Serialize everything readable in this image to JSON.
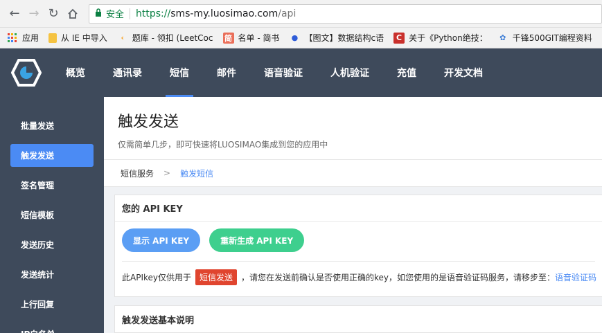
{
  "browser": {
    "secure_label": "安全",
    "url_proto": "https://",
    "url_host": "sms-my.luosimao.com",
    "url_path": "/api"
  },
  "bookmarks": [
    {
      "label": "应用",
      "icon": "apps-grid-icon",
      "color": "#e94235"
    },
    {
      "label": "从 IE 中导入",
      "icon": "folder-icon",
      "color": "#f5c342"
    },
    {
      "label": "题库 - 领扣 (LeetCoc",
      "icon": "leetcode-icon",
      "color": "#f89f1b"
    },
    {
      "label": "名单 - 简书",
      "icon": "jianshu-icon",
      "color": "#ea6f5a"
    },
    {
      "label": "【图文】数据结构c语",
      "icon": "baidu-paw-icon",
      "color": "#2e5cd8"
    },
    {
      "label": "关于《Python绝技：",
      "icon": "csdn-icon",
      "color": "#c9302c"
    },
    {
      "label": "千锋500GIT编程资料",
      "icon": "cloud-icon",
      "color": "#3a7bd5"
    }
  ],
  "topnav": [
    {
      "label": "概览",
      "active": false
    },
    {
      "label": "通讯录",
      "active": false
    },
    {
      "label": "短信",
      "active": true
    },
    {
      "label": "邮件",
      "active": false
    },
    {
      "label": "语音验证",
      "active": false
    },
    {
      "label": "人机验证",
      "active": false
    },
    {
      "label": "充值",
      "active": false
    },
    {
      "label": "开发文档",
      "active": false
    }
  ],
  "sidebar": [
    {
      "label": "批量发送",
      "active": false
    },
    {
      "label": "触发发送",
      "active": true
    },
    {
      "label": "签名管理",
      "active": false
    },
    {
      "label": "短信模板",
      "active": false
    },
    {
      "label": "发送历史",
      "active": false
    },
    {
      "label": "发送统计",
      "active": false
    },
    {
      "label": "上行回复",
      "active": false
    },
    {
      "label": "IP白名单",
      "active": false
    }
  ],
  "page": {
    "title": "触发发送",
    "subtitle": "仅需简单几步，即可快速将LUOSIMAO集成到您的应用中"
  },
  "breadcrumb": {
    "root": "短信服务",
    "sep": ">",
    "current": "触发短信"
  },
  "api_card": {
    "title": "您的 API KEY",
    "show_btn": "显示 API KEY",
    "regen_btn": "重新生成 API KEY",
    "note_before": "此APIkey仅供用于",
    "note_badge": "短信发送",
    "note_after": "，请您在发送前确认是否使用正确的key，如您使用的是语音验证码服务，请移步至：",
    "note_link": "语音验证码"
  },
  "info_card": {
    "title": "触发发送基本说明"
  },
  "colors": {
    "header_bg": "#3e4a5b",
    "accent": "#4b8bf4",
    "green": "#3ecf8e",
    "badge_red": "#e0452f"
  }
}
